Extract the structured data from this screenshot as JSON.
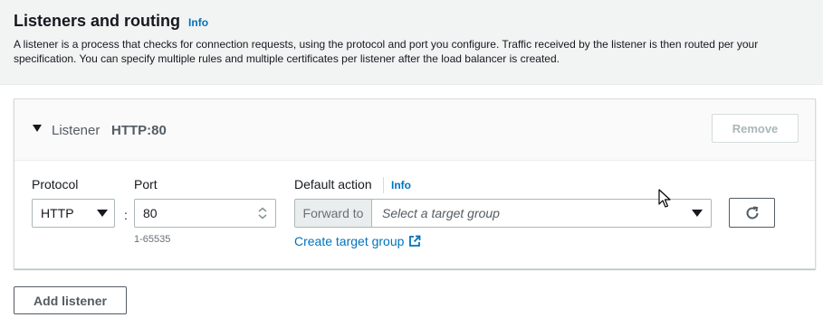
{
  "section": {
    "title": "Listeners and routing",
    "info_label": "Info",
    "description": "A listener is a process that checks for connection requests, using the protocol and port you configure. Traffic received by the listener is then routed per your specification. You can specify multiple rules and multiple certificates per listener after the load balancer is created."
  },
  "listener": {
    "label": "Listener",
    "value": "HTTP:80",
    "remove_label": "Remove",
    "protocol": {
      "label": "Protocol",
      "value": "HTTP"
    },
    "separator": ":",
    "port": {
      "label": "Port",
      "value": "80",
      "hint": "1-65535"
    },
    "default_action": {
      "label": "Default action",
      "info_label": "Info",
      "prefix": "Forward to",
      "placeholder": "Select a target group",
      "create_link": "Create target group"
    }
  },
  "add_listener_label": "Add listener",
  "icons": {
    "caret": "caret-down-icon",
    "select_arrow": "triangle-down-icon",
    "stepper": "stepper-icon",
    "external": "external-link-icon",
    "refresh": "refresh-icon",
    "cursor": "mouse-pointer-icon"
  },
  "colors": {
    "link": "#0073bb",
    "header_bg": "#f2f3f3",
    "border": "#aab7b8",
    "disabled_text": "#aab7b8"
  }
}
